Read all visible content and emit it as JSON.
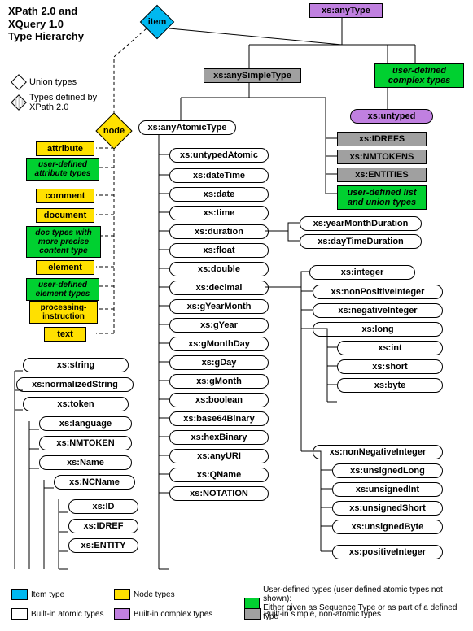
{
  "title1": "XPath 2.0 and",
  "title2": "XQuery 1.0",
  "title3": "Type Hierarchy",
  "legend_union": "Union types",
  "legend_xpath": "Types defined by XPath 2.0",
  "item": "item",
  "node": "node",
  "anyType": "xs:anyType",
  "anySimpleType": "xs:anySimpleType",
  "anyAtomicType": "xs:anyAtomicType",
  "untyped": "xs:untyped",
  "userComplex": "user-defined complex types",
  "idrefs": "xs:IDREFS",
  "nmtokens": "xs:NMTOKENS",
  "entities": "xs:ENTITIES",
  "userListUnion": "user-defined list and union types",
  "yearMonthDur": "xs:yearMonthDuration",
  "dayTimeDur": "xs:dayTimeDuration",
  "node_attribute": "attribute",
  "node_userAttr": "user-defined attribute types",
  "node_comment": "comment",
  "node_document": "document",
  "node_docPrecise": "doc types with more precise content type",
  "node_element": "element",
  "node_userElem": "user-defined element types",
  "node_procInstr": "processing-instruction",
  "node_text": "text",
  "atomic": {
    "untypedAtomic": "xs:untypedAtomic",
    "dateTime": "xs:dateTime",
    "date": "xs:date",
    "time": "xs:time",
    "duration": "xs:duration",
    "float": "xs:float",
    "double": "xs:double",
    "decimal": "xs:decimal",
    "gYearMonth": "xs:gYearMonth",
    "gYear": "xs:gYear",
    "gMonthDay": "xs:gMonthDay",
    "gDay": "xs:gDay",
    "gMonth": "xs:gMonth",
    "boolean": "xs:boolean",
    "base64Binary": "xs:base64Binary",
    "hexBinary": "xs:hexBinary",
    "anyURI": "xs:anyURI",
    "QName": "xs:QName",
    "NOTATION": "xs:NOTATION"
  },
  "str": {
    "string": "xs:string",
    "normalizedString": "xs:normalizedString",
    "token": "xs:token",
    "language": "xs:language",
    "NMTOKEN": "xs:NMTOKEN",
    "Name": "xs:Name",
    "NCName": "xs:NCName",
    "ID": "xs:ID",
    "IDREF": "xs:IDREF",
    "ENTITY": "xs:ENTITY"
  },
  "int": {
    "integer": "xs:integer",
    "nonPositive": "xs:nonPositiveInteger",
    "negative": "xs:negativeInteger",
    "long": "xs:long",
    "intt": "xs:int",
    "short": "xs:short",
    "byte": "xs:byte",
    "nonNegative": "xs:nonNegativeInteger",
    "unsignedLong": "xs:unsignedLong",
    "unsignedInt": "xs:unsignedInt",
    "unsignedShort": "xs:unsignedShort",
    "unsignedByte": "xs:unsignedByte",
    "positive": "xs:positiveInteger"
  },
  "leg": {
    "item": "Item type",
    "node": "Node types",
    "atom": "Built-in atomic types",
    "complex": "Built-in complex types",
    "user": "User-defined types (user defined atomic types not shown):\nEither given as Sequence Type or as part of a defined type",
    "simple": "Built-in simple, non-atomic types"
  }
}
